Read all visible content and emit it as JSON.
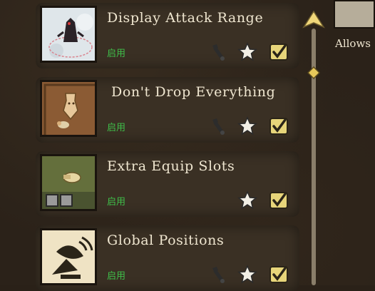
{
  "mods": [
    {
      "title": "Display Attack Range",
      "status": "启用"
    },
    {
      "title": "Don't Drop Everything",
      "status": "启用"
    },
    {
      "title": "Extra Equip Slots",
      "status": "启用"
    },
    {
      "title": "Global Positions",
      "status": "启用"
    }
  ],
  "side_panel": {
    "label": "Allows"
  },
  "icons": {
    "config": "wrench-icon",
    "favorite": "star-icon",
    "enabled": "checkbox-icon"
  },
  "colors": {
    "status": "#3fbf4a",
    "title": "#efe6d0",
    "card": "#3a3024"
  }
}
